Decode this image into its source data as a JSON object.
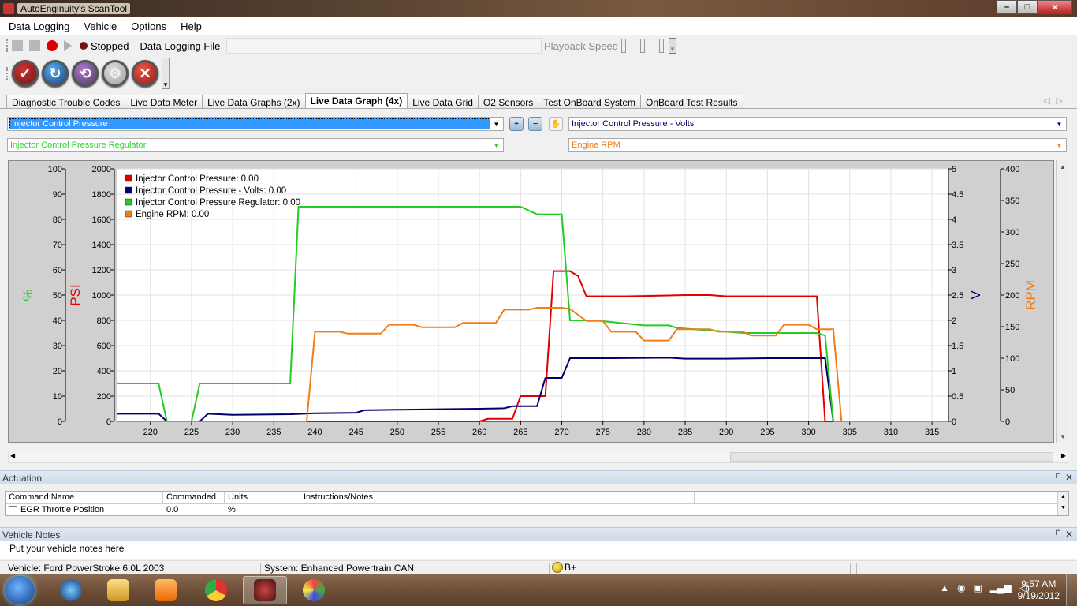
{
  "window": {
    "title": "AutoEnginuity's ScanTool"
  },
  "menu": [
    "Data Logging",
    "Vehicle",
    "Options",
    "Help"
  ],
  "logging": {
    "status": "Stopped",
    "file_label": "Data Logging File",
    "playback_label": "Playback Speed"
  },
  "tabs": [
    "Diagnostic Trouble Codes",
    "Live Data Meter",
    "Live Data Graphs (2x)",
    "Live Data Graph (4x)",
    "Live Data Grid",
    "O2 Sensors",
    "Test OnBoard System",
    "OnBoard Test Results"
  ],
  "active_tab": "Live Data Graph (4x)",
  "selectors": {
    "left_top": "Injector Control Pressure",
    "left_bottom": "Injector Control Pressure Regulator",
    "right_top": "Injector Control Pressure - Volts",
    "right_bottom": "Engine RPM"
  },
  "chart_data": {
    "type": "line",
    "xlim": [
      216,
      317
    ],
    "x_ticks": [
      220,
      225,
      230,
      235,
      240,
      245,
      250,
      255,
      260,
      265,
      270,
      275,
      280,
      285,
      290,
      295,
      300,
      305,
      310,
      315
    ],
    "axes": {
      "pct": {
        "label": "%",
        "color": "#22cc22",
        "ylim": [
          0,
          100
        ],
        "ticks": [
          0,
          10,
          20,
          30,
          40,
          50,
          60,
          70,
          80,
          90,
          100
        ]
      },
      "psi": {
        "label": "PSI",
        "color": "#e00000",
        "ylim": [
          0,
          2000
        ],
        "ticks": [
          0,
          200,
          400,
          600,
          800,
          1000,
          1200,
          1400,
          1600,
          1800,
          2000
        ]
      },
      "volt": {
        "label": "V",
        "color": "#00006e",
        "ylim": [
          0,
          5
        ],
        "ticks": [
          "0",
          "0.5",
          "1",
          "1.5",
          "2",
          "2.5",
          "3",
          "3.5",
          "4",
          "4.5",
          "5"
        ]
      },
      "rpm": {
        "label": "RPM",
        "color": "#ef7d18",
        "ylim": [
          0,
          400
        ],
        "ticks": [
          0,
          50,
          100,
          150,
          200,
          250,
          300,
          350,
          400
        ]
      }
    },
    "grid": true,
    "legend_position": "top-left",
    "series": [
      {
        "name": "Injector Control Pressure",
        "legend_value": "0.00",
        "axis": "psi",
        "color": "#e00000",
        "points": [
          [
            216,
            0
          ],
          [
            225,
            0
          ],
          [
            226,
            0
          ],
          [
            260,
            0
          ],
          [
            261,
            20
          ],
          [
            264,
            20
          ],
          [
            265,
            200
          ],
          [
            268,
            200
          ],
          [
            269,
            1190
          ],
          [
            271,
            1190
          ],
          [
            272,
            1150
          ],
          [
            273,
            990
          ],
          [
            278,
            990
          ],
          [
            285,
            1000
          ],
          [
            288,
            1000
          ],
          [
            290,
            990
          ],
          [
            301,
            990
          ],
          [
            302,
            0
          ],
          [
            317,
            0
          ]
        ]
      },
      {
        "name": "Injector Control Pressure - Volts",
        "legend_value": "0.00",
        "axis": "volt",
        "color": "#00006e",
        "points": [
          [
            216,
            0.15
          ],
          [
            220,
            0.15
          ],
          [
            221,
            0.15
          ],
          [
            222,
            0
          ],
          [
            226,
            0
          ],
          [
            227,
            0.15
          ],
          [
            230,
            0.13
          ],
          [
            237,
            0.14
          ],
          [
            240,
            0.16
          ],
          [
            245,
            0.17
          ],
          [
            246,
            0.22
          ],
          [
            250,
            0.23
          ],
          [
            255,
            0.24
          ],
          [
            260,
            0.25
          ],
          [
            263,
            0.26
          ],
          [
            264,
            0.3
          ],
          [
            267,
            0.3
          ],
          [
            268,
            0.86
          ],
          [
            270,
            0.86
          ],
          [
            271,
            1.25
          ],
          [
            276,
            1.25
          ],
          [
            283,
            1.26
          ],
          [
            285,
            1.24
          ],
          [
            290,
            1.24
          ],
          [
            295,
            1.25
          ],
          [
            302,
            1.25
          ],
          [
            303,
            0
          ],
          [
            317,
            0
          ]
        ]
      },
      {
        "name": "Injector Control Pressure Regulator",
        "legend_value": "0.00",
        "axis": "pct",
        "color": "#22cc22",
        "points": [
          [
            216,
            15
          ],
          [
            220,
            15
          ],
          [
            221,
            15
          ],
          [
            222,
            0
          ],
          [
            225,
            0
          ],
          [
            226,
            15
          ],
          [
            237,
            15
          ],
          [
            238,
            85
          ],
          [
            265,
            85
          ],
          [
            267,
            82
          ],
          [
            270,
            82
          ],
          [
            271,
            40
          ],
          [
            274,
            40
          ],
          [
            280,
            38
          ],
          [
            283,
            38
          ],
          [
            284,
            37
          ],
          [
            288,
            36
          ],
          [
            292,
            35
          ],
          [
            301,
            35
          ],
          [
            302,
            34
          ],
          [
            303,
            0
          ],
          [
            317,
            0
          ]
        ]
      },
      {
        "name": "Engine RPM",
        "legend_value": "0.00",
        "axis": "rpm",
        "color": "#ef7d18",
        "points": [
          [
            216,
            0
          ],
          [
            239,
            0
          ],
          [
            240,
            142
          ],
          [
            243,
            142
          ],
          [
            244,
            139
          ],
          [
            248,
            139
          ],
          [
            249,
            153
          ],
          [
            252,
            153
          ],
          [
            253,
            149
          ],
          [
            257,
            149
          ],
          [
            258,
            156
          ],
          [
            262,
            156
          ],
          [
            263,
            177
          ],
          [
            266,
            177
          ],
          [
            267,
            180
          ],
          [
            270,
            180
          ],
          [
            271,
            178
          ],
          [
            273,
            159
          ],
          [
            275,
            159
          ],
          [
            276,
            142
          ],
          [
            279,
            142
          ],
          [
            280,
            128
          ],
          [
            283,
            128
          ],
          [
            284,
            146
          ],
          [
            288,
            146
          ],
          [
            289,
            142
          ],
          [
            292,
            142
          ],
          [
            293,
            136
          ],
          [
            296,
            136
          ],
          [
            297,
            153
          ],
          [
            300,
            153
          ],
          [
            301,
            146
          ],
          [
            303,
            146
          ],
          [
            304,
            0
          ],
          [
            317,
            0
          ]
        ]
      }
    ]
  },
  "actuation": {
    "title": "Actuation",
    "columns": [
      "Command Name",
      "Commanded",
      "Units",
      "Instructions/Notes"
    ],
    "rows": [
      {
        "name": "EGR Throttle Position",
        "commanded": "0.0",
        "units": "%",
        "notes": ""
      }
    ]
  },
  "notes": {
    "title": "Vehicle Notes",
    "text": "Put your vehicle notes here"
  },
  "status": {
    "vehicle": "Vehicle: Ford  PowerStroke 6.0L  2003",
    "system": "System: Enhanced Powertrain CAN",
    "connection": "B+"
  },
  "taskbar": {
    "time": "9:57 AM",
    "date": "9/19/2012"
  }
}
